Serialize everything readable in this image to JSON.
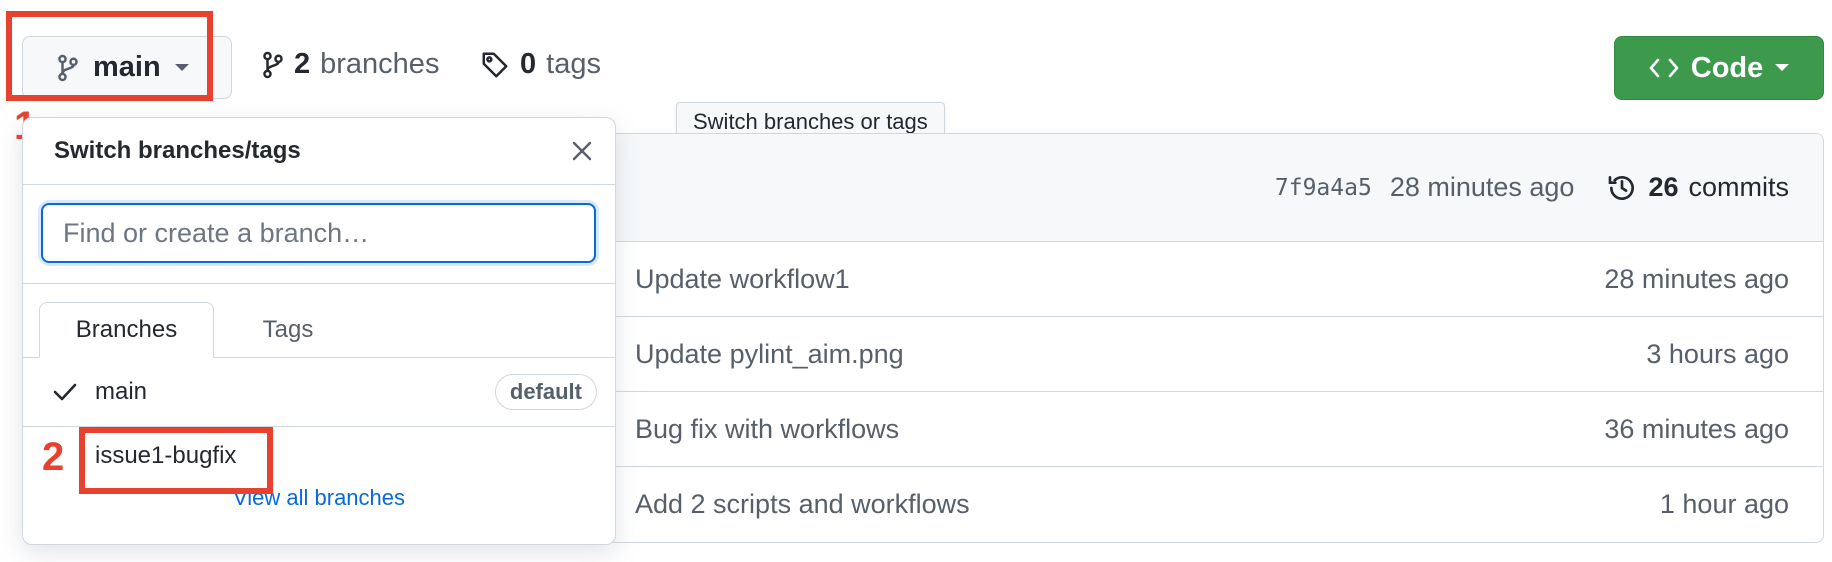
{
  "header": {
    "branch_button_label": "main",
    "branches_count": "2",
    "branches_label": "branches",
    "tags_count": "0",
    "tags_label": "tags",
    "code_button_label": "Code",
    "tooltip": "Switch branches or tags"
  },
  "annotations": {
    "first": "1",
    "second": "2"
  },
  "dropdown": {
    "title": "Switch branches/tags",
    "filter_placeholder": "Find or create a branch…",
    "tabs": [
      "Branches",
      "Tags"
    ],
    "branches": [
      {
        "name": "main",
        "badge": "default",
        "selected": true
      },
      {
        "name": "issue1-bugfix"
      }
    ],
    "view_all": "View all branches"
  },
  "latest_commit": {
    "sha": "7f9a4a5",
    "time": "28 minutes ago",
    "commits_count": "26",
    "commits_label": "commits"
  },
  "files": [
    {
      "message": "Update workflow1",
      "time": "28 minutes ago"
    },
    {
      "message": "Update pylint_aim.png",
      "time": "3 hours ago"
    },
    {
      "message": "Bug fix with workflows",
      "time": "36 minutes ago"
    },
    {
      "message": "Add 2 scripts and workflows",
      "time": "1 hour ago"
    }
  ],
  "colors": {
    "accent": "#0969da",
    "code_button": "#3d9a4d",
    "annotation": "#e8412f"
  }
}
